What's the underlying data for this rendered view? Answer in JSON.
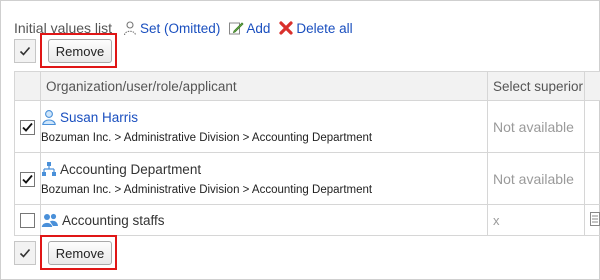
{
  "header": {
    "title": "Initial values list",
    "set_label": "Set (Omitted)",
    "add_label": "Add",
    "delete_all_label": "Delete all"
  },
  "buttons": {
    "remove_label": "Remove"
  },
  "table": {
    "columns": [
      "Organization/user/role/applicant",
      "Select superior"
    ],
    "rows": [
      {
        "type": "user",
        "name": "Susan Harris",
        "path": "Bozuman Inc. > Administrative Division > Accounting Department",
        "superior": "Not available",
        "checked": true
      },
      {
        "type": "organization",
        "name": "Accounting Department",
        "path": "Bozuman Inc. > Administrative Division > Accounting Department",
        "superior": "Not available",
        "checked": true
      },
      {
        "type": "role",
        "name": "Accounting staffs",
        "path": "",
        "superior": "x",
        "checked": false
      }
    ]
  },
  "colors": {
    "link": "#1a4fbf",
    "highlight": "#e01616",
    "header_bg": "#f2f2f2",
    "muted": "#9a9a9a"
  }
}
